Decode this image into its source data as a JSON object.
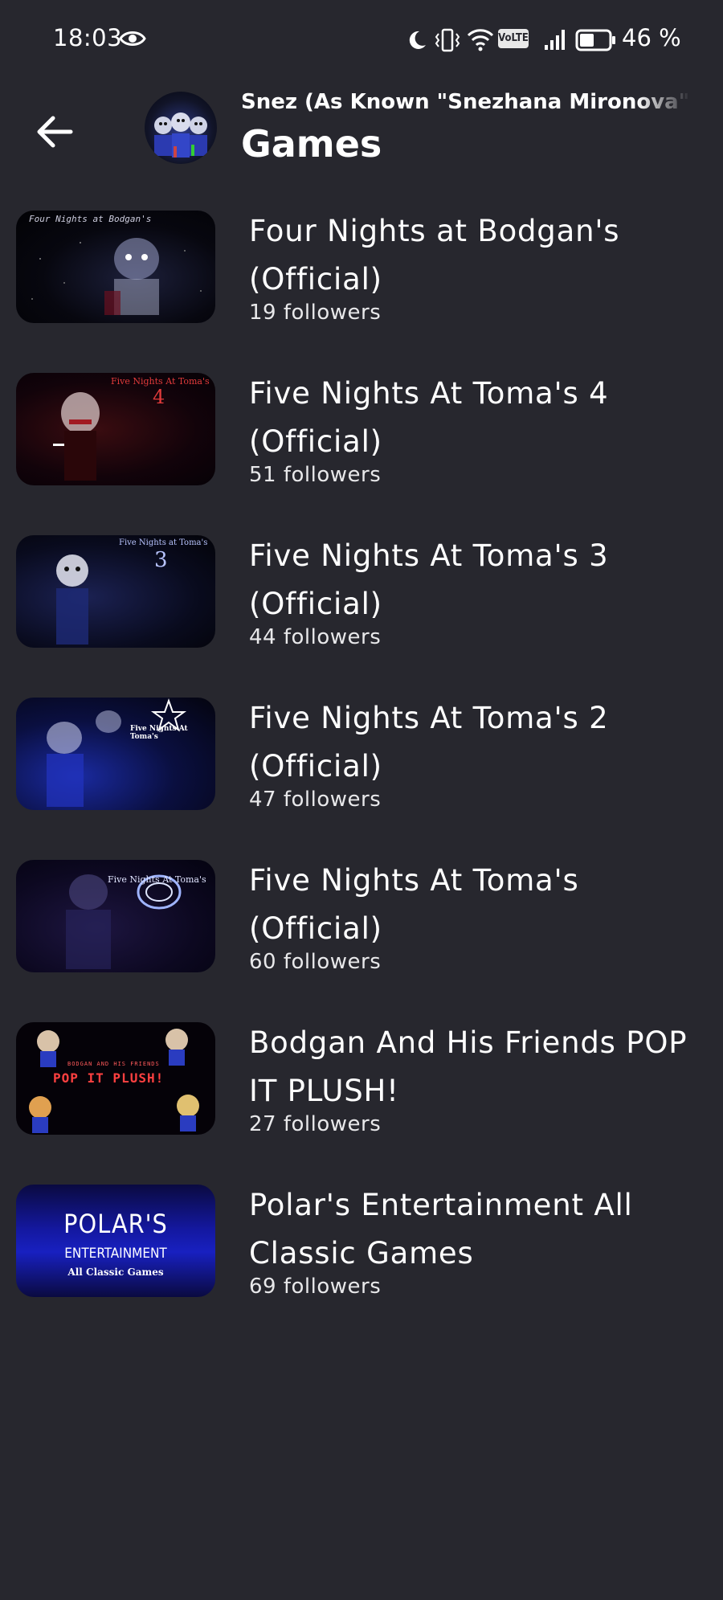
{
  "status_bar": {
    "time": "18:03",
    "battery": "46 %",
    "network_badge": "VoLTE"
  },
  "header": {
    "subtitle": "Snez (As Known \"Snezhana Mironova\") #g",
    "title": "Games"
  },
  "games": [
    {
      "title_line1": "Four Nights at Bodgan's",
      "title_line2": "(Official)",
      "followers": "19 followers",
      "thumb_text": "Four Nights at Bodgan's"
    },
    {
      "title_line1": "Five Nights At Toma's 4",
      "title_line2": "(Official)",
      "followers": "51 followers",
      "thumb_text": "Five Nights At Toma's",
      "thumb_number": "4"
    },
    {
      "title_line1": "Five Nights At Toma's 3",
      "title_line2": "(Official)",
      "followers": "44 followers",
      "thumb_text": "Five Nights at Toma's",
      "thumb_number": "3"
    },
    {
      "title_line1": "Five Nights At Toma's 2",
      "title_line2": "(Official)",
      "followers": "47 followers",
      "thumb_text": "Five Nights At Toma's"
    },
    {
      "title_line1": "Five Nights At Toma's",
      "title_line2": "(Official)",
      "followers": "60 followers",
      "thumb_text": "Five Nights At Toma's"
    },
    {
      "title_line1": "Bodgan And His Friends POP",
      "title_line2": "IT PLUSH!",
      "followers": "27 followers",
      "thumb_text_small": "BODGAN AND HIS FRIENDS",
      "thumb_text": "POP IT PLUSH!"
    },
    {
      "title_line1": "Polar's Entertainment All",
      "title_line2": "Classic Games",
      "followers": "69 followers",
      "thumb_text": "POLAR'S",
      "thumb_text_2": "ENTERTAINMENT",
      "thumb_text_3": "All Classic Games"
    }
  ]
}
